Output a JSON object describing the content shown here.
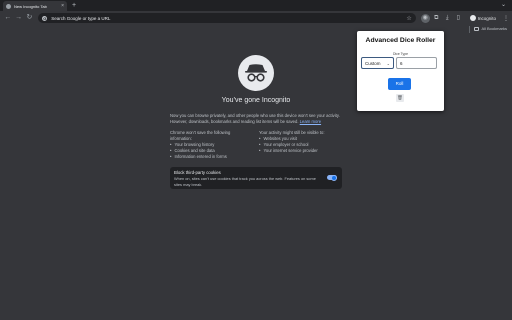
{
  "browser": {
    "tab": {
      "title": "New Incognito Tab",
      "close_glyph": "×"
    },
    "new_tab_glyph": "+",
    "strip_expand_glyph": "⌄",
    "nav": {
      "back": "←",
      "forward": "→",
      "reload": "↻"
    },
    "omnibox": {
      "icon_letter": "G",
      "placeholder": "Search Google or type a URL",
      "star_glyph": "☆"
    },
    "incognito_label": "Incognito",
    "menu_glyph": "⋮",
    "toolbar_icons": [
      {
        "name": "dice-extension-icon",
        "glyph": "◉",
        "active": true
      },
      {
        "name": "puzzle-icon",
        "glyph": "⧉",
        "active": false
      },
      {
        "name": "download-icon",
        "glyph": "⤓",
        "active": false
      },
      {
        "name": "sidepanel-icon",
        "glyph": "▯",
        "active": false
      }
    ],
    "bookmarks": {
      "all_bookmarks": "All Bookmarks"
    }
  },
  "incognito_page": {
    "heading": "You’ve gone Incognito",
    "intro_text": "Now you can browse privately, and other people who use this device won’t see your activity. However, downloads, bookmarks and reading list items will be saved.",
    "learn_more": "Learn more",
    "left_column": {
      "heading": "Chrome won’t save the following information:",
      "items": [
        "Your browsing history",
        "Cookies and site data",
        "Information entered in forms"
      ]
    },
    "right_column": {
      "heading": "Your activity might still be visible to:",
      "items": [
        "Websites you visit",
        "Your employer or school",
        "Your internet service provider"
      ]
    },
    "cookie_card": {
      "title": "Block third-party cookies",
      "description": "When on, sites can’t use cookies that track you across the web. Features on some sites may break.",
      "toggle_on": true
    }
  },
  "popup": {
    "title": "Advanced Dice Roller",
    "dice_type_label": "Dice Type",
    "dice_type_value": "Custom",
    "custom_sides_value": "6",
    "roll_label": "Roll",
    "trash_glyph": "🗑",
    "colors": {
      "accent": "#1a73e8"
    }
  }
}
